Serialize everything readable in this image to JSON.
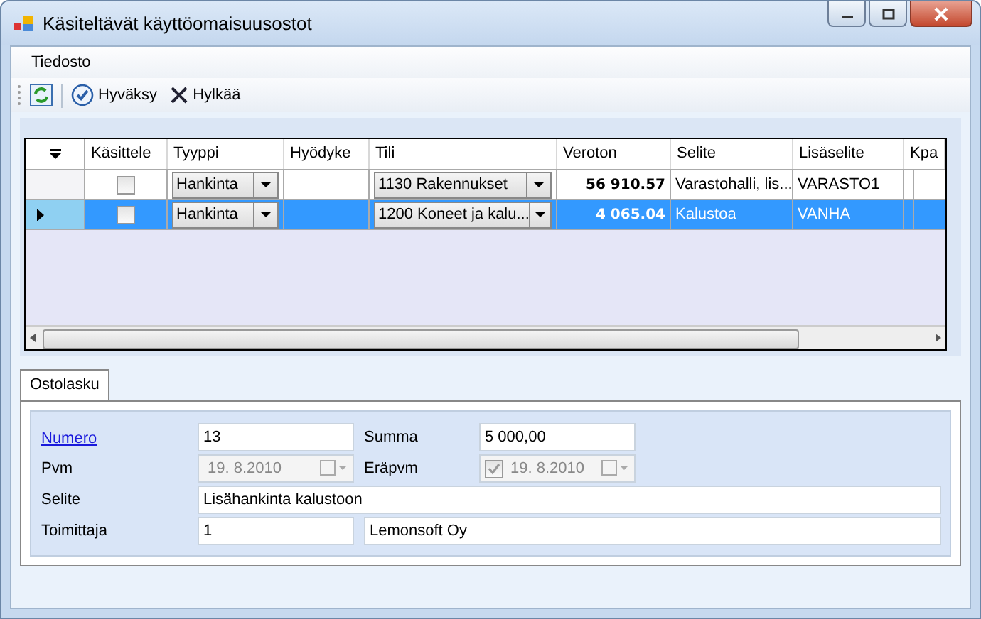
{
  "window": {
    "title": "Käsiteltävät käyttöomaisuusostot"
  },
  "menu": [
    "Tiedosto"
  ],
  "toolbar": [
    {
      "kind": "refresh"
    },
    {
      "kind": "approve",
      "label": "Hyväksy"
    },
    {
      "kind": "reject",
      "label": "Hylkää"
    }
  ],
  "table": {
    "columns": [
      "Käsittele",
      "Tyyppi",
      "Hyödyke",
      "Tili",
      "Veroton",
      "Selite",
      "Lisäselite",
      "Kpa"
    ],
    "rows": [
      {
        "selected": false,
        "checked": false,
        "type": "Hankinta",
        "asset": "",
        "account": "1130 Rakennukset",
        "net": "56 910.57",
        "description": "Varastohalli, lis...",
        "extra": "VARASTO1"
      },
      {
        "selected": true,
        "checked": false,
        "type": "Hankinta",
        "asset": "",
        "account": "1200 Koneet ja kalu...",
        "net": "4 065.04",
        "description": "Kalustoa",
        "extra": "VANHA"
      }
    ]
  },
  "tabs": [
    {
      "label": "Ostolasku",
      "selected": true
    }
  ],
  "form": {
    "number_label": "Numero",
    "number": "13",
    "sum_label": "Summa",
    "sum": "5 000,00",
    "date_label": "Pvm",
    "date": "19.  8.2010",
    "date_disabled": true,
    "due_label": "Eräpvm",
    "due": "19.  8.2010",
    "due_checked": true,
    "due_disabled": true,
    "description_label": "Selite",
    "description": "Lisähankinta kalustoon",
    "supplier_label": "Toimittaja",
    "supplier_id": "1",
    "supplier_name": "Lemonsoft Oy"
  }
}
